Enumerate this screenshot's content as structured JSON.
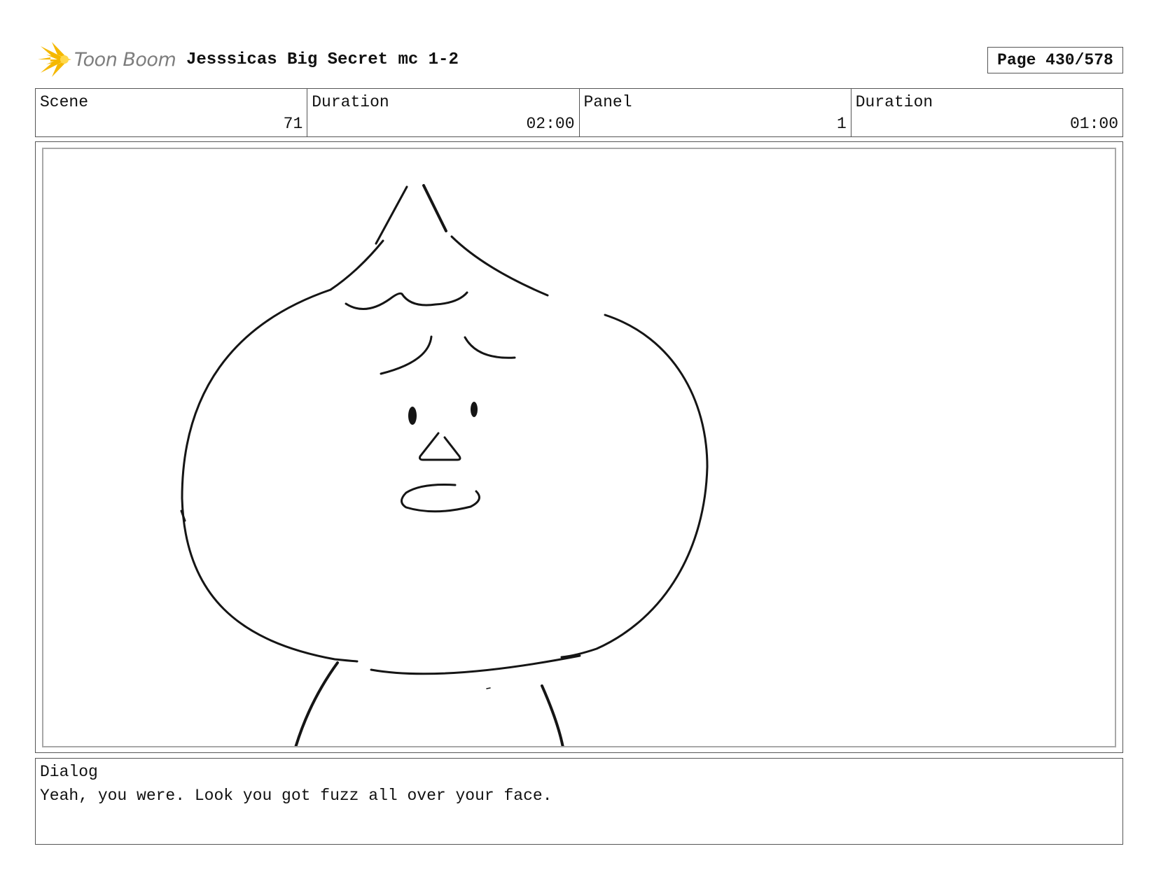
{
  "header": {
    "logo_text": "Toon Boom",
    "title": "Jesssicas Big Secret mc 1-2",
    "page": "Page 430/578"
  },
  "info": [
    {
      "label": "Scene",
      "value": "71"
    },
    {
      "label": "Duration",
      "value": "02:00"
    },
    {
      "label": "Panel",
      "value": "1"
    },
    {
      "label": "Duration",
      "value": "01:00"
    }
  ],
  "dialog": {
    "label": "Dialog",
    "text": "Yeah, you were. Look you got fuzz all over your face."
  },
  "colors": {
    "logo_star": "#f5b800",
    "logo_text": "#7d7d7d",
    "border": "#555555",
    "panel_inner_border": "#a8a8a8"
  }
}
